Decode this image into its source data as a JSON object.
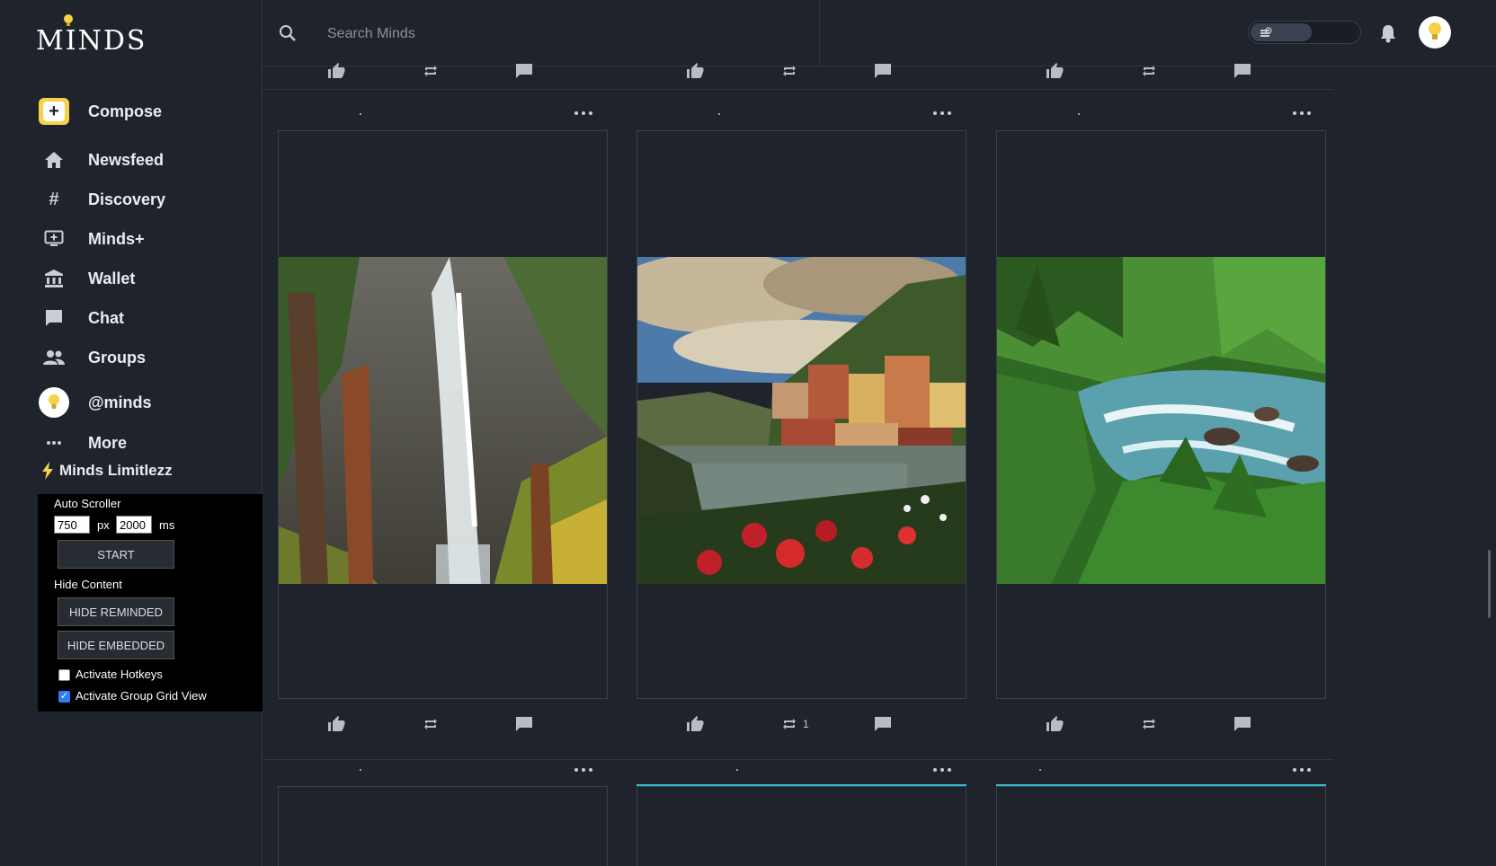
{
  "app": {
    "brand": "MINDS",
    "accent": "#f5d24a"
  },
  "sidebar": {
    "compose_label": "Compose",
    "items": [
      {
        "label": "Newsfeed",
        "icon": "home-icon"
      },
      {
        "label": "Discovery",
        "icon": "hash-icon"
      },
      {
        "label": "Minds+",
        "icon": "plus-screen-icon"
      },
      {
        "label": "Wallet",
        "icon": "bank-icon"
      },
      {
        "label": "Chat",
        "icon": "chat-icon"
      },
      {
        "label": "Groups",
        "icon": "groups-icon"
      },
      {
        "label": "@minds",
        "icon": "avatar"
      },
      {
        "label": "More",
        "icon": "more-icon"
      }
    ],
    "extension_title": "Minds Limitlezz"
  },
  "extension_panel": {
    "auto_scroller_label": "Auto Scroller",
    "px_value": "750",
    "px_unit": "px",
    "ms_value": "2000",
    "ms_unit": "ms",
    "start_label": "START",
    "hide_content_label": "Hide Content",
    "hide_reminded_label": "HIDE REMINDED",
    "hide_embedded_label": "HIDE EMBEDDED",
    "activate_hotkeys_label": "Activate Hotkeys",
    "activate_hotkeys_checked": false,
    "activate_group_grid_label": "Activate Group Grid View",
    "activate_group_grid_checked": true
  },
  "topbar": {
    "search_placeholder": "Search Minds"
  },
  "feed": {
    "posts": [
      {
        "image": "waterfall-photo",
        "remind_count": ""
      },
      {
        "image": "lakeside-village-photo",
        "remind_count": "1"
      },
      {
        "image": "forest-river-photo",
        "remind_count": ""
      }
    ]
  }
}
